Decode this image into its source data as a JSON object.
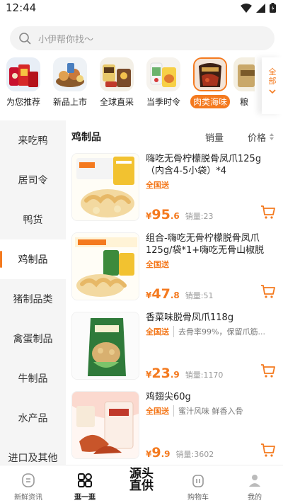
{
  "status": {
    "time": "12:44"
  },
  "search": {
    "placeholder": "小伊帮你找～"
  },
  "categories": [
    {
      "label": "为您推荐"
    },
    {
      "label": "新品上市"
    },
    {
      "label": "全球直采"
    },
    {
      "label": "当季时令"
    },
    {
      "label": "肉类海味",
      "active": true
    },
    {
      "label": "粮"
    }
  ],
  "cat_all": "全部",
  "sidebar": {
    "items": [
      {
        "label": "来吃鸭"
      },
      {
        "label": "居司令"
      },
      {
        "label": "鸭货"
      },
      {
        "label": "鸡制品",
        "active": true
      },
      {
        "label": "猪制品类"
      },
      {
        "label": "禽蛋制品"
      },
      {
        "label": "牛制品"
      },
      {
        "label": "水产品"
      },
      {
        "label": "进口及其他"
      }
    ]
  },
  "content": {
    "title": "鸡制品",
    "sort_sales": "销量",
    "sort_price": "价格"
  },
  "products": [
    {
      "title": "嗨吃无骨柠檬脱骨凤爪125g（内含4-5小袋）*4",
      "country": "全国送",
      "sub": "",
      "currency": "¥",
      "price_int": "95",
      "price_dec": ".6",
      "sold": "销量:23"
    },
    {
      "title": "组合-嗨吃无骨柠檬脱骨凤爪125g/袋*1+嗨吃无骨山椒脱骨...",
      "country": "全国送",
      "sub": "",
      "currency": "¥",
      "price_int": "47",
      "price_dec": ".8",
      "sold": "销量:51"
    },
    {
      "title": "香菜味脱骨凤爪118g",
      "country": "全国送",
      "sub": "去骨率99%，保留爪筋...",
      "currency": "¥",
      "price_int": "23",
      "price_dec": ".9",
      "sold": "销量:1170"
    },
    {
      "title": "鸡翅尖60g",
      "country": "全国送",
      "sub": "蜜汁风味 鲜香入骨",
      "currency": "¥",
      "price_int": "9",
      "price_dec": ".9",
      "sold": "销量:3602"
    }
  ],
  "bottom_nav": [
    {
      "label": "新鲜资讯"
    },
    {
      "label": "逛一逛",
      "active": true
    },
    {
      "label": "源头直供",
      "center": true
    },
    {
      "label": "购物车"
    },
    {
      "label": "我的"
    }
  ],
  "colors": {
    "accent": "#f47a1f",
    "sidebar_bg": "#f5f5f5"
  }
}
